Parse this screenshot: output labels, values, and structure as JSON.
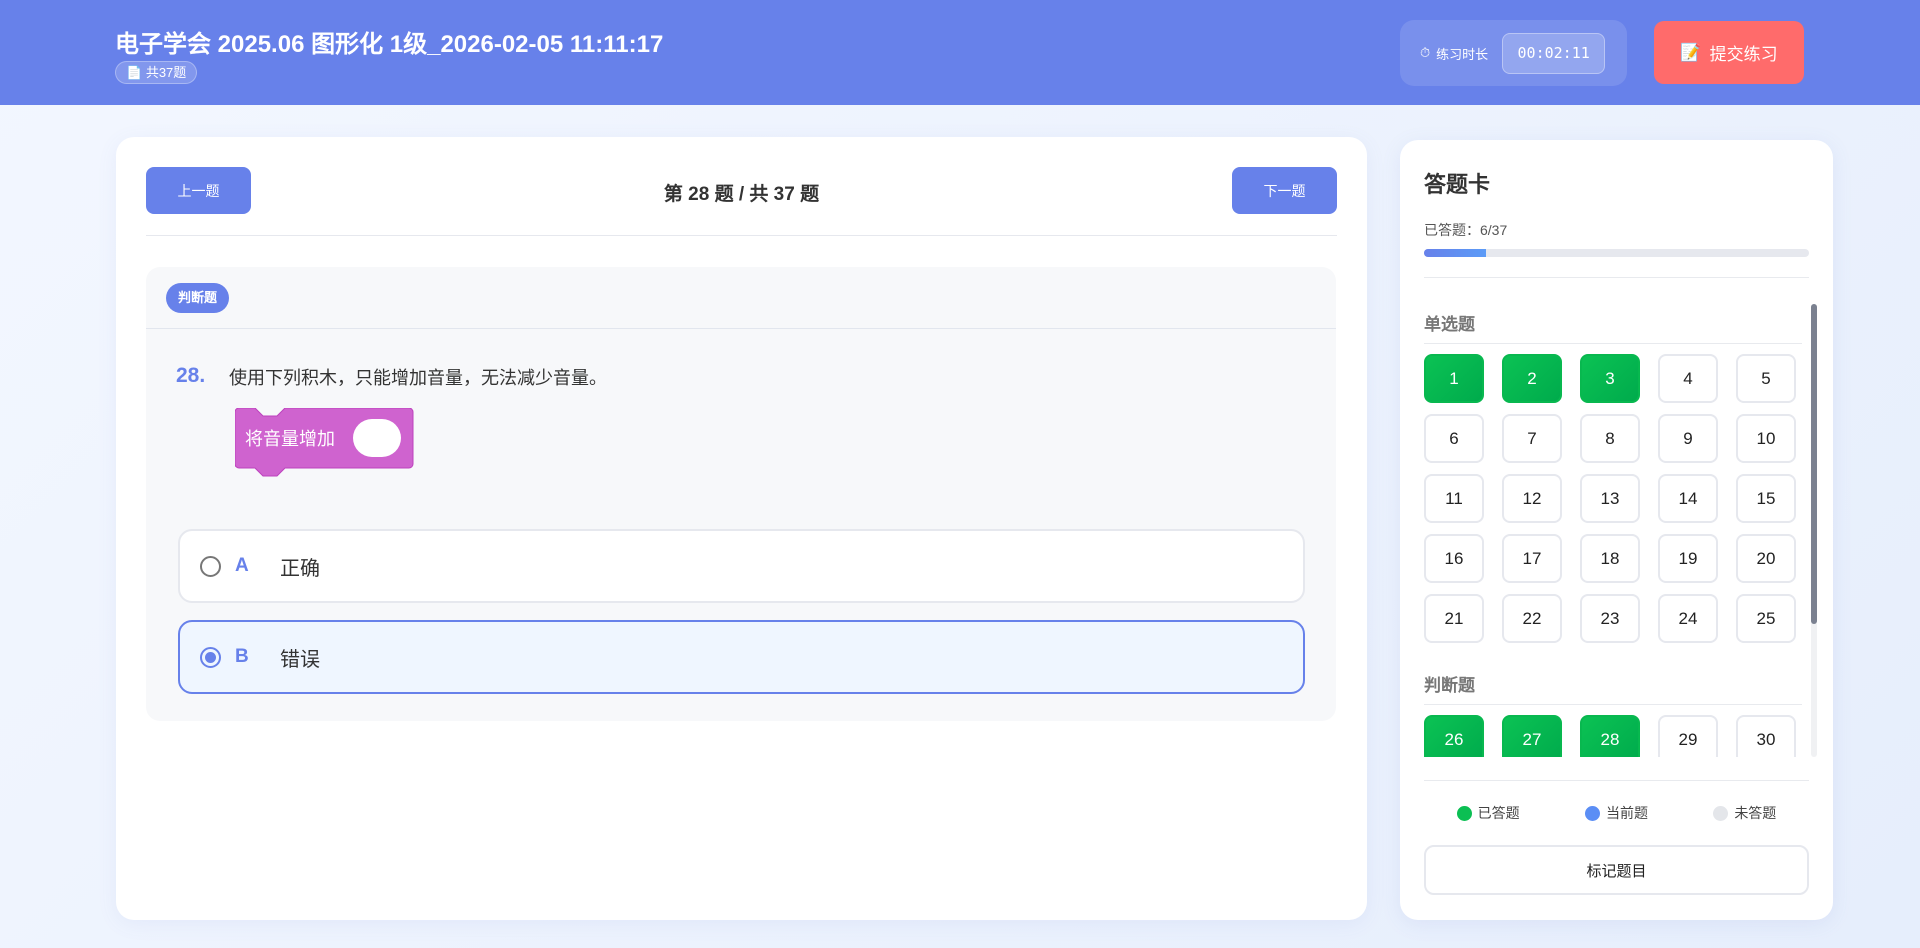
{
  "header": {
    "title": "电子学会 2025.06 图形化 1级_2026-02-05 11:11:17",
    "count_badge": "共37题",
    "timer_label": "练习时长",
    "timer_value": "00:02:11",
    "submit_label": "提交练习"
  },
  "question": {
    "prev_label": "上一题",
    "next_label": "下一题",
    "progress_title": "第 28 题 / 共 37 题",
    "type_tag": "判断题",
    "number": "28.",
    "text": "使用下列积木，只能增加音量，无法减少音量。",
    "block_label": "将音量增加",
    "block_color": "#cf63cf",
    "options": [
      {
        "letter": "A",
        "text": "正确",
        "selected": false
      },
      {
        "letter": "B",
        "text": "错误",
        "selected": true
      }
    ]
  },
  "answer_card": {
    "title": "答题卡",
    "answered_text": "已答题：6/37",
    "progress_fraction": 0.162,
    "sections": [
      {
        "title": "单选题",
        "items": [
          {
            "n": "1",
            "done": true
          },
          {
            "n": "2",
            "done": true
          },
          {
            "n": "3",
            "done": true
          },
          {
            "n": "4"
          },
          {
            "n": "5"
          },
          {
            "n": "6"
          },
          {
            "n": "7"
          },
          {
            "n": "8"
          },
          {
            "n": "9"
          },
          {
            "n": "10"
          },
          {
            "n": "11"
          },
          {
            "n": "12"
          },
          {
            "n": "13"
          },
          {
            "n": "14"
          },
          {
            "n": "15"
          },
          {
            "n": "16"
          },
          {
            "n": "17"
          },
          {
            "n": "18"
          },
          {
            "n": "19"
          },
          {
            "n": "20"
          },
          {
            "n": "21"
          },
          {
            "n": "22"
          },
          {
            "n": "23"
          },
          {
            "n": "24"
          },
          {
            "n": "25"
          }
        ]
      },
      {
        "title": "判断题",
        "items": [
          {
            "n": "26",
            "done": true
          },
          {
            "n": "27",
            "done": true
          },
          {
            "n": "28",
            "done": true
          },
          {
            "n": "29"
          },
          {
            "n": "30"
          }
        ]
      }
    ],
    "legend": [
      {
        "label": "已答题",
        "color": "#0bbf53"
      },
      {
        "label": "当前题",
        "color": "#5b8ef5"
      },
      {
        "label": "未答题",
        "color": "#e4e6ea"
      }
    ],
    "mark_label": "标记题目"
  },
  "colors": {
    "accent": "#6781ea",
    "submit": "#ff6b6b",
    "answered": "#0bbf53"
  }
}
